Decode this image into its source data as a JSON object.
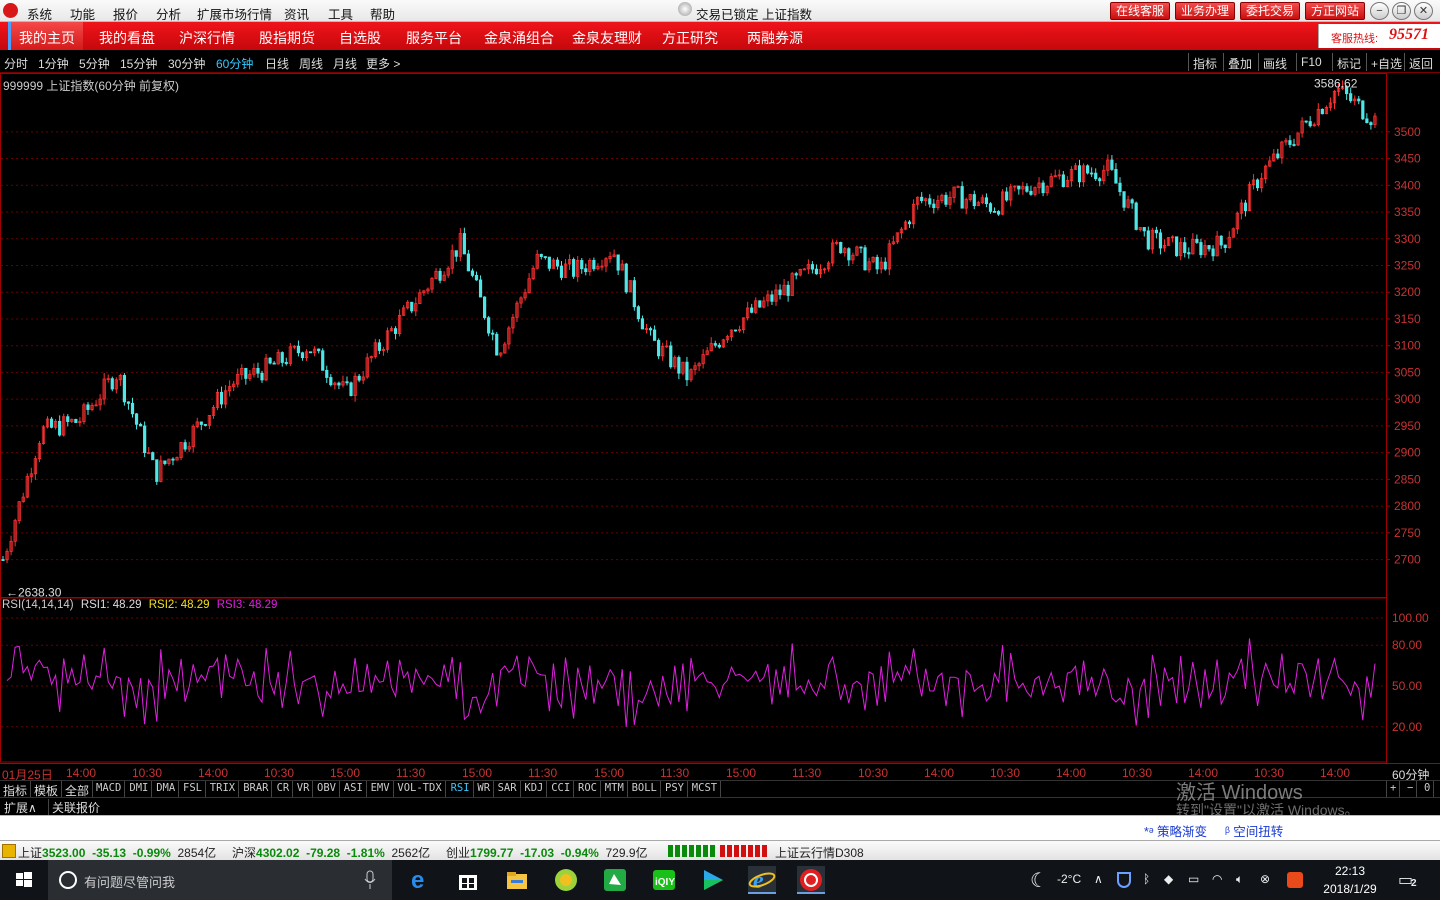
{
  "menu": {
    "items": [
      "系统",
      "功能",
      "报价",
      "分析",
      "扩展市场行情",
      "资讯",
      "工具",
      "帮助"
    ],
    "window_title": "交易已锁定  上证指数",
    "header_buttons": [
      "在线客服",
      "业务办理",
      "委托交易",
      "方正网站"
    ]
  },
  "nav": {
    "items": [
      "我的主页",
      "我的看盘",
      "沪深行情",
      "股指期货",
      "自选股",
      "服务平台",
      "金泉涌组合",
      "金泉友理财",
      "方正研究",
      "两融券源"
    ],
    "hotline_label": "客服热线:",
    "hotline_number": "95571"
  },
  "periods": [
    "分时",
    "1分钟",
    "5分钟",
    "15分钟",
    "30分钟",
    "60分钟",
    "日线",
    "周线",
    "月线",
    "更多 >"
  ],
  "active_period": "60分钟",
  "tools": [
    "指标",
    "叠加",
    "画线",
    "F10",
    "标记",
    "+自选",
    "返回"
  ],
  "main_chart": {
    "title": "999999 上证指数(60分钟 前复权)",
    "high_label": "3586.62",
    "low_label": "←2638.30",
    "ticks": [
      "3500",
      "3450",
      "3400",
      "3350",
      "3300",
      "3250",
      "3200",
      "3150",
      "3100",
      "3050",
      "3000",
      "2950",
      "2900",
      "2850",
      "2800",
      "2750",
      "2700"
    ]
  },
  "rsi": {
    "label": "RSI(14,14,14)",
    "rsi1": "RSI1: 48.29",
    "rsi2": "RSI2: 48.29",
    "rsi3": "RSI3: 48.29",
    "ticks": [
      "100.00",
      "80.00",
      "50.00",
      "20.00"
    ]
  },
  "time_axis": [
    "01月25日",
    "14:00",
    "10:30",
    "14:00",
    "10:30",
    "15:00",
    "11:30",
    "15:00",
    "11:30",
    "15:00",
    "11:30",
    "15:00",
    "11:30",
    "10:30",
    "14:00",
    "10:30",
    "14:00",
    "10:30",
    "14:00",
    "10:30",
    "14:00"
  ],
  "time_axis_right": "60分钟",
  "indicator_tabs": [
    "指标",
    "模板",
    "全部",
    "MACD",
    "DMI",
    "DMA",
    "FSL",
    "TRIX",
    "BRAR",
    "CR",
    "VR",
    "OBV",
    "ASI",
    "EMV",
    "VOL-TDX",
    "RSI",
    "WR",
    "SAR",
    "KDJ",
    "CCI",
    "ROC",
    "MTM",
    "BOLL",
    "PSY",
    "MCST"
  ],
  "active_indicator": "RSI",
  "indicator_right": [
    "+",
    "−",
    "0"
  ],
  "extension": [
    "扩展∧",
    "关联报价"
  ],
  "watermark": {
    "line1": "激活 Windows",
    "line2": "转到\"设置\"以激活 Windows。"
  },
  "links": [
    "策略渐变",
    "空间扭转"
  ],
  "status": {
    "sh_name": "上证",
    "sh_value": "3523.00",
    "sh_change": "-35.13",
    "sh_pct": "-0.99%",
    "sh_amt": "2854亿",
    "hs_name": "沪深",
    "hs_value": "4302.02",
    "hs_change": "-79.28",
    "hs_pct": "-1.81%",
    "hs_amt": "2562亿",
    "cy_name": "创业",
    "cy_value": "1799.77",
    "cy_change": "-17.03",
    "cy_pct": "-0.94%",
    "cy_amt": "729.9亿",
    "cloud": "上证云行情D308"
  },
  "taskbar": {
    "search_placeholder": "有问题尽管问我",
    "temperature": "-2°C",
    "time": "22:13",
    "date": "2018/1/29",
    "notif_count": "2"
  },
  "chart_data": [
    {
      "type": "candlestick",
      "title": "999999 上证指数(60分钟 前复权)",
      "xlabel": "",
      "ylabel": "",
      "ylim": [
        2630,
        3610
      ],
      "annotations": {
        "high": 3586.62,
        "low": 2638.3
      },
      "x": [
        "01月25日",
        "14:00",
        "10:30",
        "14:00",
        "10:30",
        "15:00",
        "11:30",
        "15:00",
        "11:30",
        "15:00",
        "11:30",
        "15:00",
        "11:30",
        "10:30",
        "14:00",
        "10:30",
        "14:00",
        "10:30",
        "14:00",
        "10:30",
        "14:00"
      ],
      "close_trend": [
        2700,
        2940,
        2960,
        3050,
        2860,
        2940,
        3030,
        3060,
        3100,
        3010,
        3110,
        3200,
        3290,
        3090,
        3260,
        3240,
        3280,
        3110,
        3040,
        3130,
        3180,
        3230,
        3290,
        3240,
        3370,
        3380,
        3360,
        3400,
        3420,
        3430,
        3300,
        3280,
        3290,
        3420,
        3500,
        3580,
        3523
      ]
    },
    {
      "type": "line",
      "title": "RSI(14,14,14)",
      "ylim": [
        0,
        100
      ],
      "series": [
        {
          "name": "RSI1",
          "last": 48.29
        },
        {
          "name": "RSI2",
          "last": 48.29
        },
        {
          "name": "RSI3",
          "last": 48.29
        }
      ]
    }
  ]
}
